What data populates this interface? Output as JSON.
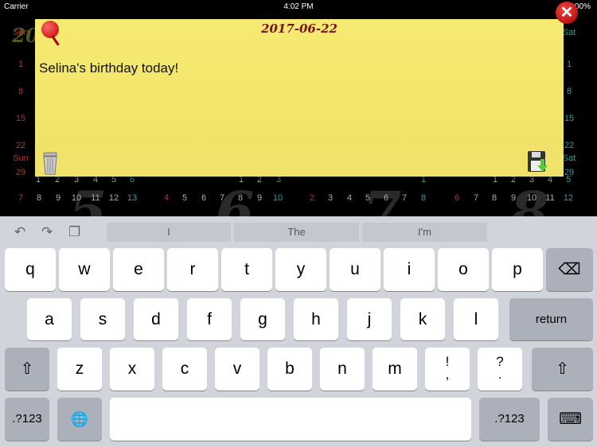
{
  "status": {
    "carrier": "Carrier",
    "time": "4:02 PM",
    "battery": "100%"
  },
  "calendar": {
    "day_sun": "Sun",
    "day_sat": "Sat",
    "year_partial": "20",
    "left_col": [
      "1",
      "8",
      "15",
      "22",
      "29"
    ],
    "right_col": [
      "1",
      "8",
      "15",
      "22",
      "29"
    ],
    "row1": [
      [
        "1",
        "gray",
        48
      ],
      [
        "2",
        "gray",
        72
      ],
      [
        "3",
        "gray",
        96
      ],
      [
        "4",
        "gray",
        120
      ],
      [
        "5",
        "gray",
        143
      ],
      [
        "6",
        "teal",
        166
      ],
      [
        "1",
        "gray",
        303
      ],
      [
        "2",
        "gray",
        326
      ],
      [
        "3",
        "teal",
        350
      ],
      [
        "1",
        "teal",
        532
      ],
      [
        "1",
        "gray",
        622
      ],
      [
        "2",
        "gray",
        645
      ],
      [
        "3",
        "gray",
        668
      ],
      [
        "4",
        "gray",
        691
      ],
      [
        "5",
        "teal",
        714
      ]
    ],
    "row2": [
      [
        "7",
        "red",
        26
      ],
      [
        "8",
        "gray",
        49
      ],
      [
        "9",
        "gray",
        73
      ],
      [
        "10",
        "gray",
        96
      ],
      [
        "11",
        "gray",
        120
      ],
      [
        "12",
        "gray",
        143
      ],
      [
        "13",
        "teal",
        166
      ],
      [
        "4",
        "red",
        209
      ],
      [
        "5",
        "gray",
        232
      ],
      [
        "6",
        "gray",
        256
      ],
      [
        "7",
        "gray",
        279
      ],
      [
        "8",
        "gray",
        302
      ],
      [
        "9",
        "gray",
        326
      ],
      [
        "10",
        "teal",
        349
      ],
      [
        "2",
        "red",
        392
      ],
      [
        "3",
        "gray",
        415
      ],
      [
        "4",
        "gray",
        439
      ],
      [
        "5",
        "gray",
        462
      ],
      [
        "6",
        "gray",
        485
      ],
      [
        "7",
        "gray",
        508
      ],
      [
        "8",
        "teal",
        532
      ],
      [
        "6",
        "red",
        574
      ],
      [
        "7",
        "gray",
        598
      ],
      [
        "8",
        "gray",
        621
      ],
      [
        "9",
        "gray",
        645
      ],
      [
        "10",
        "gray",
        668
      ],
      [
        "11",
        "gray",
        691
      ],
      [
        "12",
        "teal",
        714
      ]
    ],
    "month_digits": [
      "5",
      "6",
      "7",
      "8"
    ]
  },
  "note": {
    "date": "2017-06-22",
    "text": "Selina's birthday today!"
  },
  "icons": {
    "close": "close-icon",
    "pin": "pushpin-icon",
    "trash": "trash-icon",
    "save": "floppy-save-icon"
  },
  "keyboard": {
    "suggestions": [
      "I",
      "The",
      "I'm"
    ],
    "row1": [
      "q",
      "w",
      "e",
      "r",
      "t",
      "y",
      "u",
      "i",
      "o",
      "p"
    ],
    "row2": [
      "a",
      "s",
      "d",
      "f",
      "g",
      "h",
      "j",
      "k",
      "l"
    ],
    "row3": [
      "z",
      "x",
      "c",
      "v",
      "b",
      "n",
      "m",
      "!\n,",
      "?\n."
    ],
    "return": "return",
    "numbers": ".?123"
  }
}
